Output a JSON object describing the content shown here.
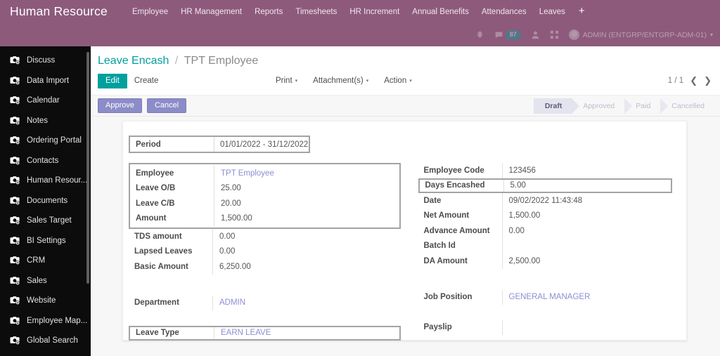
{
  "navbar": {
    "brand": "Human Resource",
    "menu": [
      "Employee",
      "HR Management",
      "Reports",
      "Timesheets",
      "HR Increment",
      "Annual Benefits",
      "Attendances",
      "Leaves"
    ],
    "add_label": "+"
  },
  "systray": {
    "message_count": "87",
    "user_name": "ADMIN (ENTGRP/ENTGRP-ADM-01)",
    "caret": "▾",
    "icons": [
      "bug-icon",
      "message-icon",
      "user-icon",
      "apps-icon",
      "avatar-icon"
    ]
  },
  "sidebar": {
    "items": [
      {
        "label": "Discuss"
      },
      {
        "label": "Data Import"
      },
      {
        "label": "Calendar"
      },
      {
        "label": "Notes"
      },
      {
        "label": "Ordering Portal"
      },
      {
        "label": "Contacts"
      },
      {
        "label": "Human Resour..."
      },
      {
        "label": "Documents"
      },
      {
        "label": "Sales Target"
      },
      {
        "label": "BI Settings"
      },
      {
        "label": "CRM"
      },
      {
        "label": "Sales"
      },
      {
        "label": "Website"
      },
      {
        "label": "Employee Map..."
      },
      {
        "label": "Global Search"
      }
    ]
  },
  "breadcrumb": {
    "root": "Leave Encash",
    "separator": "/",
    "current": "TPT Employee"
  },
  "toolbar": {
    "edit_label": "Edit",
    "create_label": "Create",
    "print_label": "Print",
    "attachments_label": "Attachment(s)",
    "action_label": "Action",
    "caret": "▾",
    "pager_text": "1 / 1",
    "prev_arrow": "❮",
    "next_arrow": "❯"
  },
  "statusbar": {
    "approve_label": "Approve",
    "cancel_label": "Cancel",
    "stages": [
      {
        "label": "Draft",
        "active": true
      },
      {
        "label": "Approved",
        "active": false
      },
      {
        "label": "Paid",
        "active": false
      },
      {
        "label": "Cancelled",
        "active": false
      }
    ]
  },
  "form": {
    "period": {
      "label": "Period",
      "value": "01/01/2022 - 31/12/2022"
    },
    "left": [
      {
        "label": "Employee",
        "value": "TPT Employee",
        "link": true
      },
      {
        "label": "Leave O/B",
        "value": "25.00",
        "link": false
      },
      {
        "label": "Leave C/B",
        "value": "20.00",
        "link": false
      },
      {
        "label": "Amount",
        "value": "1,500.00",
        "link": false
      },
      {
        "label": "TDS amount",
        "value": "0.00",
        "link": false
      },
      {
        "label": "Lapsed Leaves",
        "value": "0.00",
        "link": false
      },
      {
        "label": "Basic Amount",
        "value": "6,250.00",
        "link": false
      }
    ],
    "right": [
      {
        "label": "Employee Code",
        "value": "123456",
        "link": false
      },
      {
        "label": "Days Encashed",
        "value": "5.00",
        "link": false
      },
      {
        "label": "Date",
        "value": "09/02/2022 11:43:48",
        "link": false
      },
      {
        "label": "Net Amount",
        "value": "1,500.00",
        "link": false
      },
      {
        "label": "Advance Amount",
        "value": "0.00",
        "link": false
      },
      {
        "label": "Batch Id",
        "value": "",
        "link": false
      },
      {
        "label": "DA Amount",
        "value": "2,500.00",
        "link": false
      }
    ],
    "left_bottom": [
      {
        "label": "Department",
        "value": "ADMIN",
        "link": true
      },
      {
        "label": "Leave Type",
        "value": "EARN LEAVE",
        "link": true
      }
    ],
    "right_bottom": [
      {
        "label": "Job Position",
        "value": "GENERAL MANAGER",
        "link": true
      },
      {
        "label": "Payslip",
        "value": "",
        "link": false
      }
    ]
  },
  "colors": {
    "brand_purple": "#8d5a7c",
    "accent_teal": "#00A09D",
    "button_periwinkle": "#8c8cc8",
    "link_violet": "#8d8dd4",
    "sidebar_black": "#0c0c0c",
    "highlight_border": "#a3a3a3"
  }
}
